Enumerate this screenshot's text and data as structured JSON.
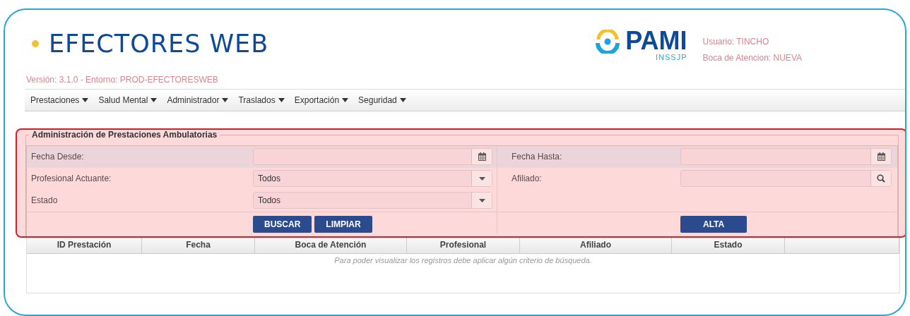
{
  "header": {
    "title": "EFECTORES WEB",
    "logo_text": "PAMI",
    "logo_subtext": "INSSJP",
    "user": "Usuario: TINCHO",
    "location": "Boca de Atencion: NUEVA",
    "version": "Versión: 3.1.0 - Entorno: PROD-EFECTORESWEB"
  },
  "menu": [
    {
      "label": "Prestaciones"
    },
    {
      "label": "Salud Mental"
    },
    {
      "label": "Administrador"
    },
    {
      "label": "Traslados"
    },
    {
      "label": "Exportación"
    },
    {
      "label": "Seguridad"
    }
  ],
  "form": {
    "legend": "Administración de Prestaciones Ambulatorias",
    "rows": [
      {
        "fields": [
          {
            "label": "Fecha Desde:",
            "kind": "date"
          },
          {
            "label": "Fecha Hasta:",
            "kind": "date"
          }
        ]
      },
      {
        "fields": [
          {
            "label": "Profesional Actuante:",
            "kind": "select",
            "value": "Todos"
          },
          {
            "label": "Afiliado:",
            "kind": "search"
          }
        ]
      },
      {
        "fields": [
          {
            "label": "Estado",
            "kind": "select",
            "value": "Todos"
          }
        ]
      }
    ],
    "buttons": [
      "BUSCAR",
      "LIMPIAR"
    ],
    "right_buttons": [
      "ALTA"
    ]
  },
  "table": {
    "columns": [
      "ID Prestación",
      "Fecha",
      "Boca de Atención",
      "Profesional",
      "Afiliado",
      "Estado"
    ],
    "empty_message": "Para poder visualizar los registros debe aplicar algún criterio de búsqueda."
  }
}
